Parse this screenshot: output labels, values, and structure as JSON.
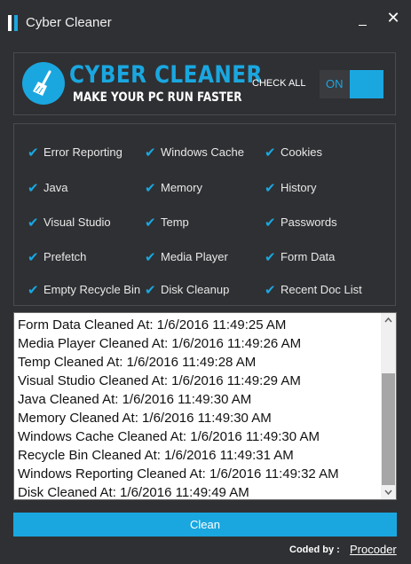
{
  "window": {
    "title": "Cyber Cleaner"
  },
  "header": {
    "brand_title": "CYBER CLEANER",
    "brand_subtitle": "MAKE YOUR PC RUN FASTER",
    "check_all_label": "CHECK ALL",
    "toggle_state": "ON"
  },
  "options": [
    {
      "label": "Error Reporting",
      "checked": true
    },
    {
      "label": "Windows Cache",
      "checked": true
    },
    {
      "label": "Cookies",
      "checked": true
    },
    {
      "label": "Java",
      "checked": true
    },
    {
      "label": "Memory",
      "checked": true
    },
    {
      "label": "History",
      "checked": true
    },
    {
      "label": "Visual Studio",
      "checked": true
    },
    {
      "label": "Temp",
      "checked": true
    },
    {
      "label": "Passwords",
      "checked": true
    },
    {
      "label": "Prefetch",
      "checked": true
    },
    {
      "label": "Media Player",
      "checked": true
    },
    {
      "label": "Form Data",
      "checked": true
    },
    {
      "label": "Empty Recycle Bin",
      "checked": true
    },
    {
      "label": "Disk Cleanup",
      "checked": true
    },
    {
      "label": "Recent Doc List",
      "checked": true
    }
  ],
  "log": [
    "Form Data Cleaned At: 1/6/2016 11:49:25 AM",
    "Media Player Cleaned At: 1/6/2016 11:49:26 AM",
    "Temp Cleaned At: 1/6/2016 11:49:28 AM",
    "Visual Studio Cleaned At: 1/6/2016 11:49:29 AM",
    "Java Cleaned At: 1/6/2016 11:49:30 AM",
    "Memory Cleaned At: 1/6/2016 11:49:30 AM",
    "Windows Cache Cleaned At: 1/6/2016 11:49:30 AM",
    "Recycle Bin Cleaned At: 1/6/2016 11:49:31 AM",
    "Windows Reporting Cleaned At: 1/6/2016 11:49:32 AM",
    "Disk Cleaned At: 1/6/2016 11:49:49 AM"
  ],
  "clean_button": "Clean",
  "footer": {
    "coded_by": "Coded by :",
    "author": "Procoder"
  },
  "colors": {
    "accent": "#1aa7e0",
    "background": "#2f3033"
  },
  "icons": {
    "app": "app-icon",
    "logo": "broom-icon",
    "check": "check-icon"
  }
}
